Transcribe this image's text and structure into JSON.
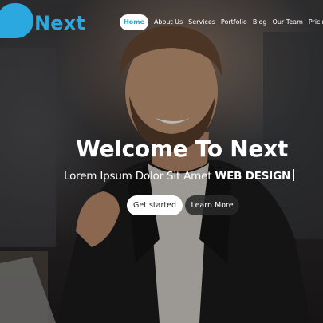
{
  "brand": {
    "name": "Next",
    "accent_color": "#2aa8df"
  },
  "nav": {
    "items": [
      {
        "label": "Home",
        "active": true
      },
      {
        "label": "About Us",
        "active": false
      },
      {
        "label": "Services",
        "active": false
      },
      {
        "label": "Portfolio",
        "active": false
      },
      {
        "label": "Blog",
        "active": false
      },
      {
        "label": "Our Team",
        "active": false
      },
      {
        "label": "Pricing",
        "active": false
      }
    ]
  },
  "hero": {
    "title": "Welcome To Next",
    "subtitle_prefix": "Lorem Ipsum Dolor Sit Amet",
    "subtitle_highlight": "WEB DESIGN",
    "primary_button": "Get started",
    "secondary_button": "Learn More"
  }
}
